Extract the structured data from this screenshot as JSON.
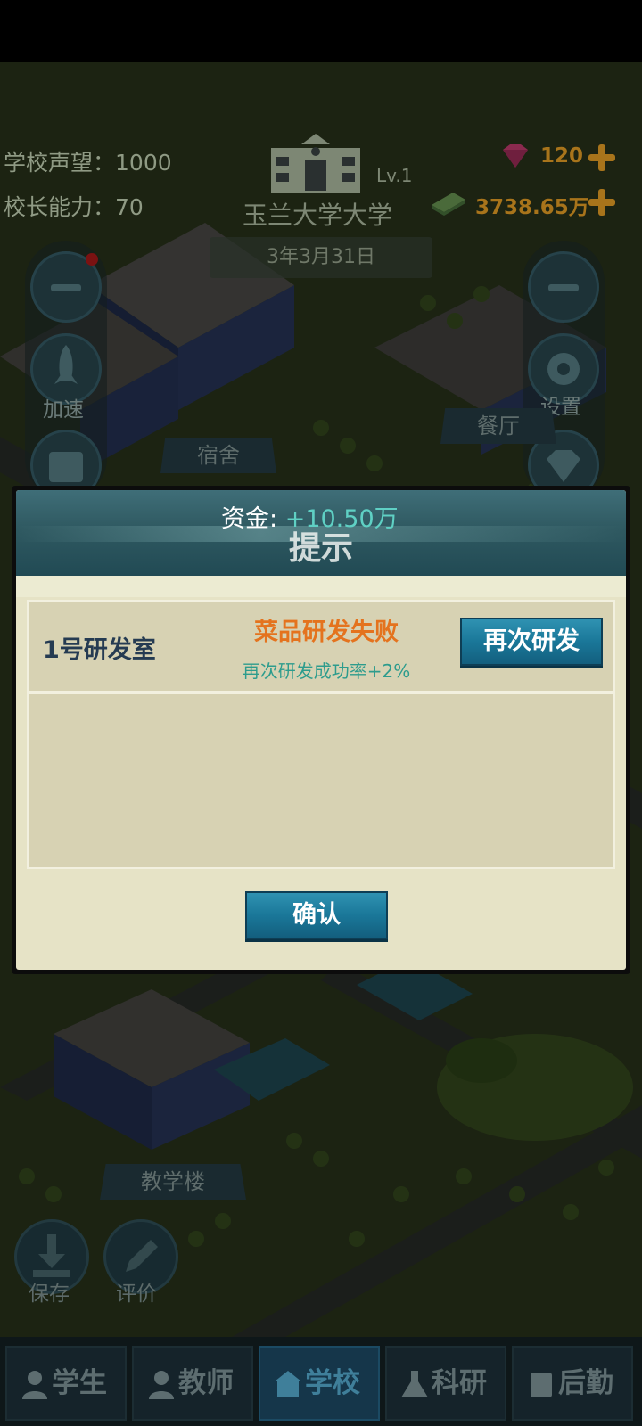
{
  "header": {
    "reputation_label": "学校声望：",
    "reputation_value": "1000",
    "ability_label": "校长能力：",
    "ability_value": "70",
    "school_name": "玉兰大学大学",
    "level": "Lv.1",
    "date": "3年3月31日",
    "gems": "120",
    "money": "3738.65万"
  },
  "side_left": {
    "speed_label": "加速"
  },
  "side_right": {
    "settings_label": "设置"
  },
  "map_labels": {
    "dorm": "宿舍",
    "canteen": "餐厅",
    "teaching": "教学楼"
  },
  "dialog": {
    "title": "提示",
    "funds_label": "资金:",
    "funds_value": "+10.50万",
    "lab_name": "1号研发室",
    "result": "菜品研发失败",
    "rate_text": "再次研发成功率+2%",
    "retry_button": "再次研发",
    "confirm_button": "确认"
  },
  "bottom_buttons": {
    "save": "保存",
    "review": "评价"
  },
  "tabs": [
    {
      "label": "学生",
      "active": false
    },
    {
      "label": "教师",
      "active": false
    },
    {
      "label": "学校",
      "active": true
    },
    {
      "label": "科研",
      "active": false
    },
    {
      "label": "后勤",
      "active": false
    }
  ],
  "colors": {
    "dialog_header": "#2f5961",
    "result_orange": "#e4731e",
    "rate_teal": "#2d9c8d",
    "button_blue": "#1a7799",
    "funds_teal": "#5fd0c4"
  }
}
